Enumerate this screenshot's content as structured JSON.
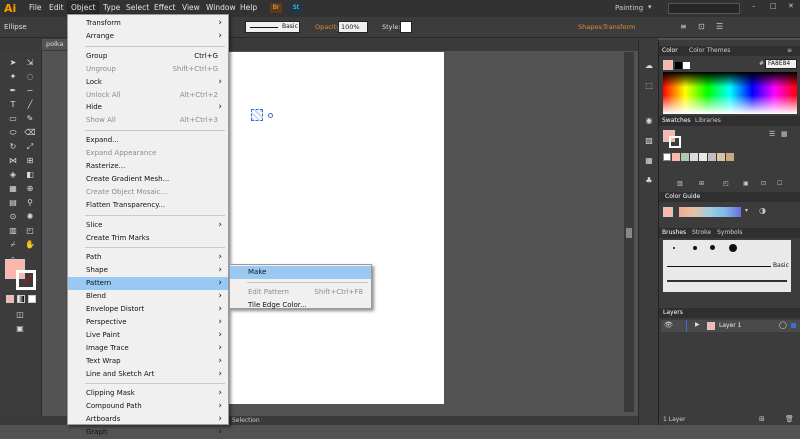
{
  "app": {
    "logo": "Ai",
    "workspace": "Painting"
  },
  "menubar": [
    "File",
    "Edit",
    "Object",
    "Type",
    "Select",
    "Effect",
    "View",
    "Window",
    "Help"
  ],
  "control_bar": {
    "selection_label": "Ellipse",
    "stroke_style": "Basic",
    "opacity_label": "Opacity:",
    "opacity_value": "100%",
    "style_label": "Style:",
    "shapes_label": "Shapes:",
    "transform_label": "Transform"
  },
  "document_tab": "polka",
  "status_text": "Selection",
  "object_menu": [
    {
      "label": "Transform",
      "submenu": true
    },
    {
      "label": "Arrange",
      "submenu": true
    },
    {
      "sep": true
    },
    {
      "label": "Group",
      "shortcut": "Ctrl+G"
    },
    {
      "label": "Ungroup",
      "shortcut": "Shift+Ctrl+G",
      "disabled": true
    },
    {
      "label": "Lock",
      "submenu": true
    },
    {
      "label": "Unlock All",
      "shortcut": "Alt+Ctrl+2",
      "disabled": true
    },
    {
      "label": "Hide",
      "submenu": true
    },
    {
      "label": "Show All",
      "shortcut": "Alt+Ctrl+3",
      "disabled": true
    },
    {
      "sep": true
    },
    {
      "label": "Expand..."
    },
    {
      "label": "Expand Appearance",
      "disabled": true
    },
    {
      "label": "Rasterize..."
    },
    {
      "label": "Create Gradient Mesh..."
    },
    {
      "label": "Create Object Mosaic...",
      "disabled": true
    },
    {
      "label": "Flatten Transparency..."
    },
    {
      "sep": true
    },
    {
      "label": "Slice",
      "submenu": true
    },
    {
      "label": "Create Trim Marks"
    },
    {
      "sep": true
    },
    {
      "label": "Path",
      "submenu": true
    },
    {
      "label": "Shape",
      "submenu": true
    },
    {
      "label": "Pattern",
      "submenu": true,
      "highlighted": true
    },
    {
      "label": "Blend",
      "submenu": true
    },
    {
      "label": "Envelope Distort",
      "submenu": true
    },
    {
      "label": "Perspective",
      "submenu": true
    },
    {
      "label": "Live Paint",
      "submenu": true
    },
    {
      "label": "Image Trace",
      "submenu": true
    },
    {
      "label": "Text Wrap",
      "submenu": true
    },
    {
      "label": "Line and Sketch Art",
      "submenu": true
    },
    {
      "sep": true
    },
    {
      "label": "Clipping Mask",
      "submenu": true
    },
    {
      "label": "Compound Path",
      "submenu": true
    },
    {
      "label": "Artboards",
      "submenu": true
    },
    {
      "label": "Graph",
      "submenu": true
    }
  ],
  "pattern_submenu": [
    {
      "label": "Make",
      "highlighted": true
    },
    {
      "sep": true
    },
    {
      "label": "Edit Pattern",
      "shortcut": "Shift+Ctrl+F8",
      "disabled": true
    },
    {
      "label": "Tile Edge Color..."
    }
  ],
  "panels": {
    "color": {
      "tabs": [
        "Color",
        "Color Themes"
      ],
      "hex": "FA8E84"
    },
    "swatches": {
      "tabs": [
        "Swatches",
        "Libraries"
      ]
    },
    "color_guide": {
      "tabs": [
        "Color Guide"
      ]
    },
    "brushes": {
      "tabs": [
        "Brushes",
        "Stroke",
        "Symbols"
      ],
      "stroke_name": "Basic"
    },
    "layers": {
      "tabs": [
        "Layers"
      ],
      "layer_name": "Layer 1",
      "count": "1 Layer"
    }
  },
  "colors": {
    "fill": "#fbb5ab",
    "accent": "#e38a3a",
    "highlight": "#99c9f2"
  }
}
